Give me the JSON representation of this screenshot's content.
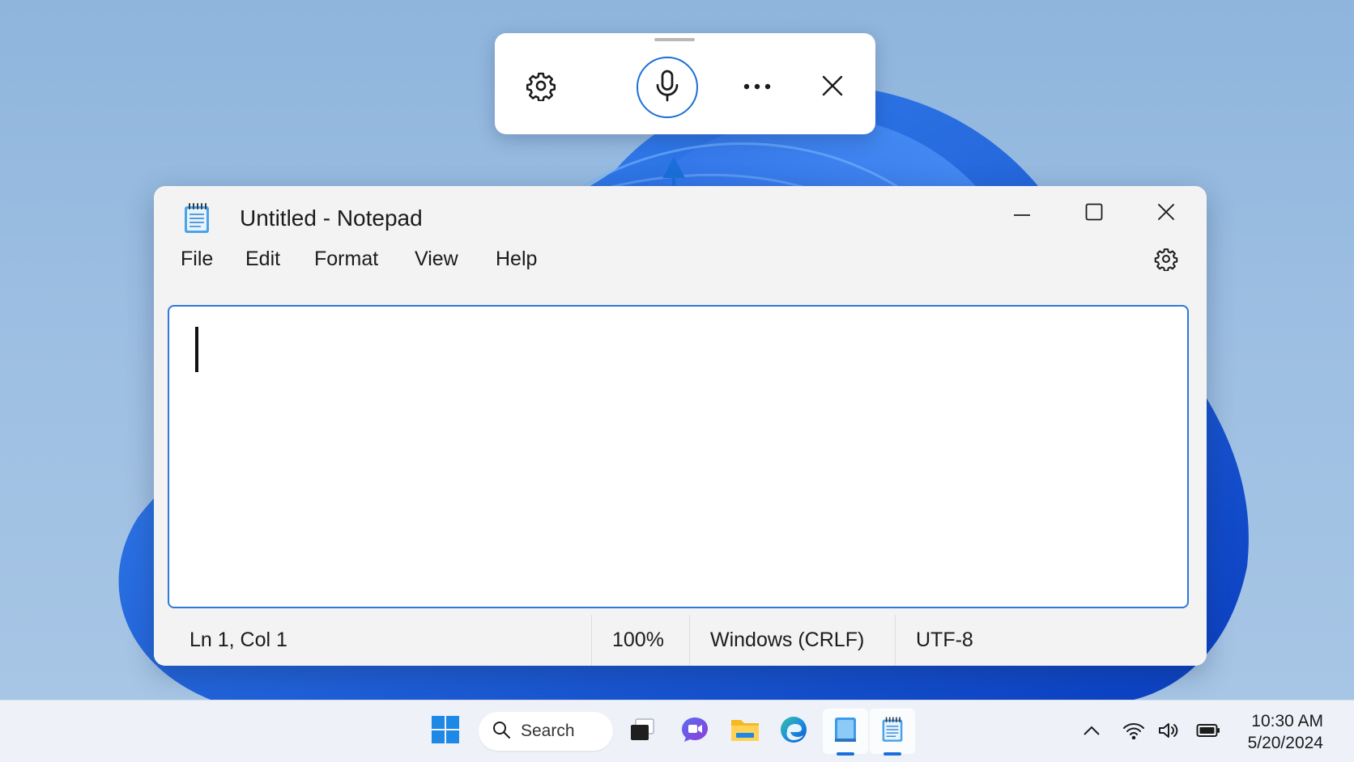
{
  "voice_toolbar": {
    "settings_icon": "gear-icon",
    "mic_icon": "microphone-icon",
    "more_icon": "more-horizontal-icon",
    "close_icon": "close-icon",
    "accent_color": "#1a6fd8"
  },
  "window": {
    "title": "Untitled - Notepad",
    "app_icon": "notepad-icon",
    "controls": [
      "minimize-icon",
      "maximize-icon",
      "close-icon"
    ]
  },
  "menu": {
    "items": [
      {
        "label": "File"
      },
      {
        "label": "Edit"
      },
      {
        "label": "Format"
      },
      {
        "label": "View"
      },
      {
        "label": "Help"
      }
    ],
    "settings_icon": "gear-icon"
  },
  "editor": {
    "text": "",
    "border_color": "#2f78dc"
  },
  "status": {
    "position": "Ln 1, Col 1",
    "zoom": "100%",
    "line_ending": "Windows (CRLF)",
    "encoding": "UTF-8"
  },
  "taskbar": {
    "search_label": "Search",
    "apps": [
      "windows-start-icon",
      "task-view-icon",
      "meet-icon",
      "file-explorer-icon",
      "edge-icon",
      "notepad-app-icon",
      "notepad-icon"
    ],
    "tray": [
      "chevron-up-icon",
      "wifi-icon",
      "volume-icon",
      "battery-icon"
    ],
    "time": "10:30 AM",
    "date": "5/20/2024"
  }
}
